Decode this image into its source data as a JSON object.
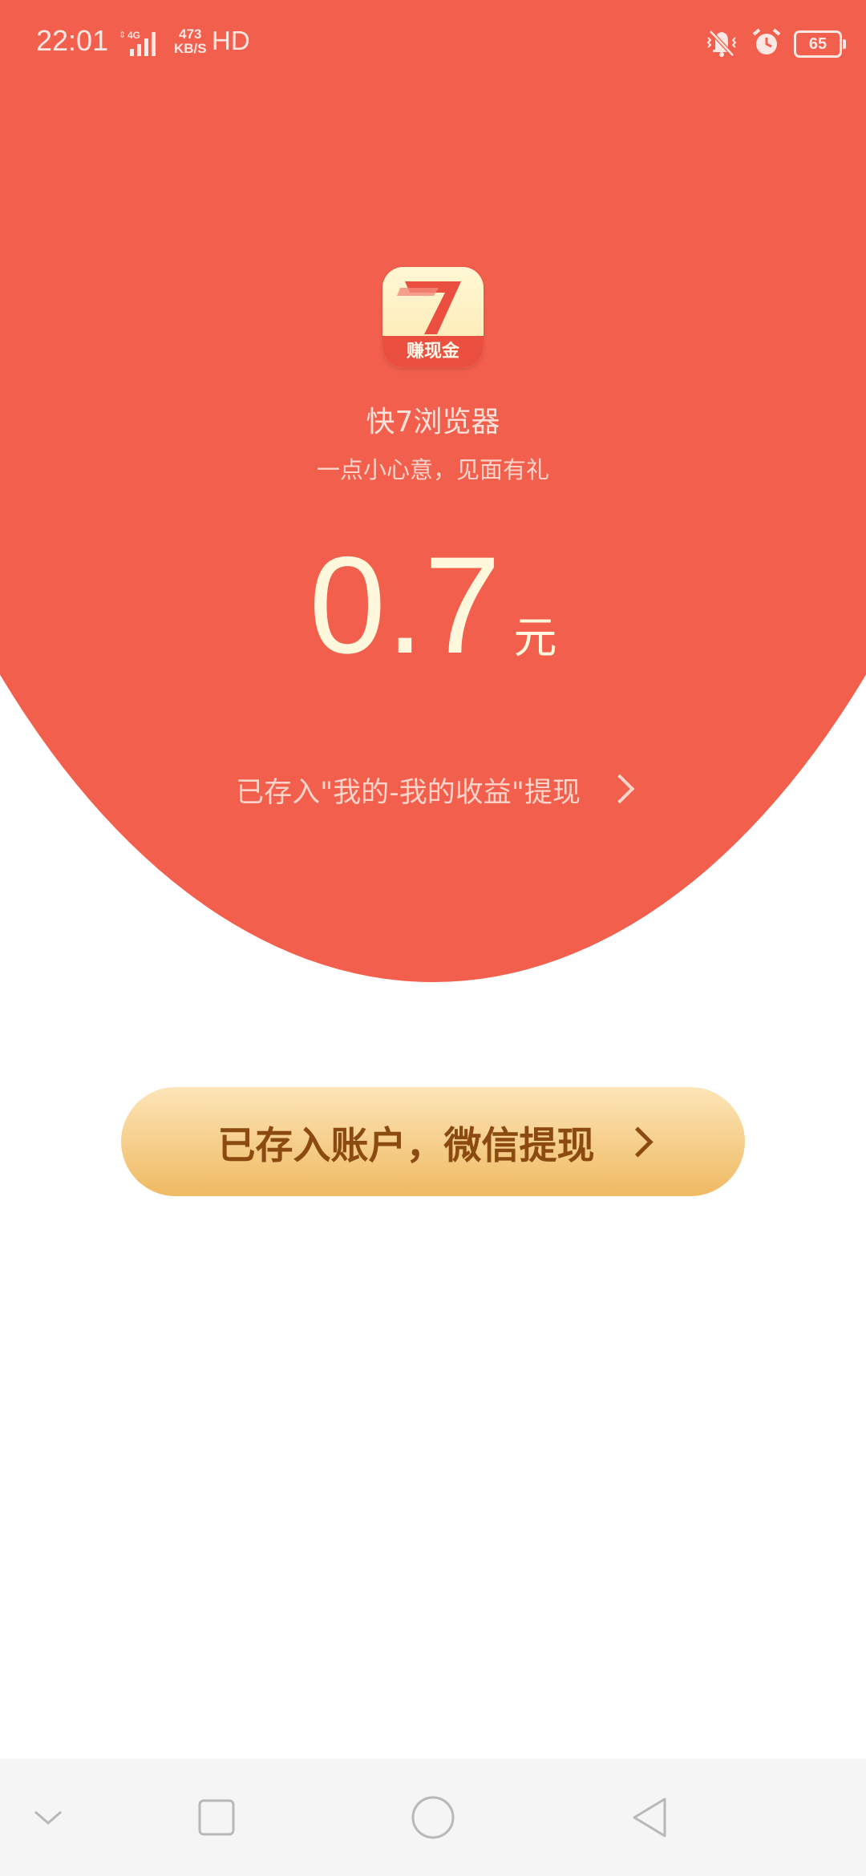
{
  "status_bar": {
    "time": "22:01",
    "network_type": "4G",
    "speed_value": "473",
    "speed_unit": "KB/S",
    "hd": "HD",
    "battery": "65",
    "icons": [
      "mute-vibrate-icon",
      "alarm-icon",
      "battery-icon"
    ]
  },
  "app": {
    "icon_band_text": "赚现金",
    "name": "快7浏览器",
    "subtitle": "一点小心意，见面有礼"
  },
  "reward": {
    "amount": "0.7",
    "unit": "元"
  },
  "stored_link": {
    "label": "已存入\"我的-我的收益\"提现"
  },
  "withdraw_button": {
    "label": "已存入账户，微信提现"
  },
  "nav": [
    "chevron-down-icon",
    "recent-apps-icon",
    "home-icon",
    "back-icon"
  ],
  "colors": {
    "header_red": "#f25f4c",
    "button_gold_top": "#fde5b8",
    "button_gold_bottom": "#efba62",
    "button_text": "#8b4a10",
    "amount_text": "#fff8dc"
  }
}
